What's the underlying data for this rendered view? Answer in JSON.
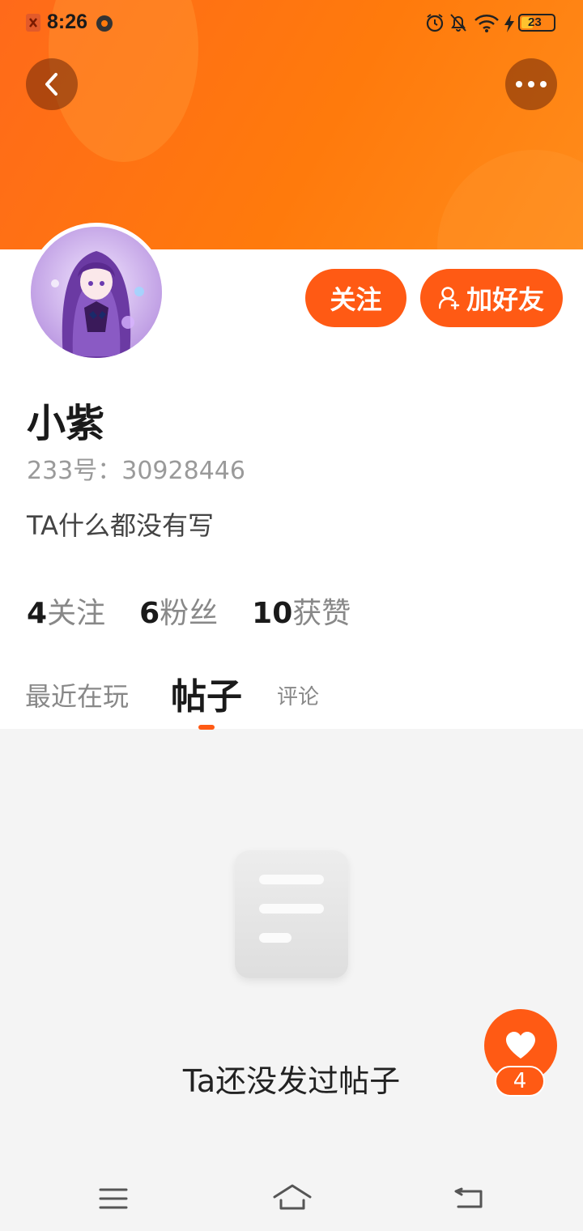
{
  "status_bar": {
    "time": "8:26",
    "battery": "23"
  },
  "header": {
    "back_icon": "chevron-left-icon",
    "more_icon": "more-horizontal-icon"
  },
  "profile": {
    "name": "小紫",
    "uid": "233号：30928446",
    "bio": "TA什么都没有写",
    "follow_label": "关注",
    "add_friend_label": "加好友"
  },
  "stats": [
    {
      "count": "4",
      "label": "关注"
    },
    {
      "count": "6",
      "label": "粉丝"
    },
    {
      "count": "10",
      "label": "获赞"
    }
  ],
  "tabs": {
    "recent": "最近在玩",
    "posts": "帖子",
    "comments": "评论",
    "active": "posts"
  },
  "empty_state": {
    "message": "Ta还没发过帖子"
  },
  "fab": {
    "icon": "heart-icon",
    "badge": "4"
  },
  "colors": {
    "accent": "#ff5a14",
    "banner": "#ff7a0c"
  }
}
